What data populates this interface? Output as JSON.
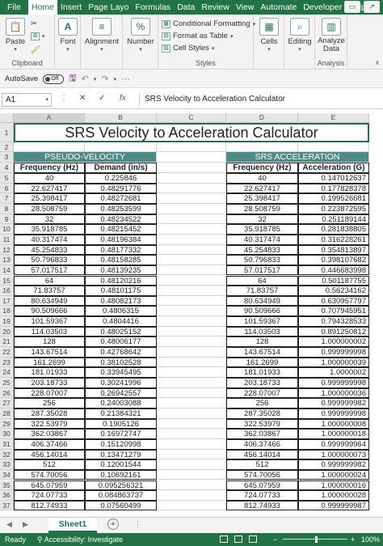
{
  "ribbon": {
    "tabs": [
      "File",
      "Home",
      "Insert",
      "Page Layout",
      "Formulas",
      "Data",
      "Review",
      "View",
      "Automate",
      "Developer",
      "Help"
    ],
    "tabs_display": [
      "File",
      "Home",
      "Insert",
      "Page Layo",
      "Formulas",
      "Data",
      "Review",
      "View",
      "Automate",
      "Developer",
      "Help"
    ],
    "active_tab": "Home",
    "clipboard": {
      "paste_label": "Paste",
      "group_label": "Clipboard"
    },
    "font_label": "Font",
    "alignment_label": "Alignment",
    "number_label": "Number",
    "styles": {
      "conditional_formatting": "Conditional Formatting",
      "format_as_table": "Format as Table",
      "cell_styles": "Cell Styles",
      "group_label": "Styles"
    },
    "cells_label": "Cells",
    "editing_label": "Editing",
    "analysis": {
      "analyze_data": "Analyze Data",
      "analyze_line1": "Analyze",
      "analyze_line2": "Data",
      "group_label": "Analysis"
    }
  },
  "qat": {
    "autosave_label": "AutoSave",
    "autosave_state": "Off"
  },
  "formula_bar": {
    "name_box": "A1",
    "cancel": "✕",
    "enter": "✓",
    "fx": "fx",
    "content": "SRS Velocity to Acceleration Calculator"
  },
  "columns": [
    "A",
    "B",
    "C",
    "D",
    "E"
  ],
  "title": "SRS Velocity to Acceleration Calculator",
  "pseudo_velocity": {
    "header": "PSEUDO-VELOCITY",
    "col1": "Frequency (Hz)",
    "col2": "Demand (in/s)"
  },
  "srs_acceleration": {
    "header": "SRS ACCELERATION",
    "col1": "Frequency (Hz)",
    "col2": "Acceleration (G)"
  },
  "rows": [
    {
      "n": "5",
      "a": "40",
      "b": "0.225846",
      "d": "40",
      "e": "0.147012637"
    },
    {
      "n": "6",
      "a": "22.627417",
      "b": "0.48291776",
      "d": "22.627417",
      "e": "0.177828378"
    },
    {
      "n": "7",
      "a": "25.398417",
      "b": "0.48272681",
      "d": "25.398417",
      "e": "0.199526681"
    },
    {
      "n": "8",
      "a": "28.508759",
      "b": "0.48253599",
      "d": "28.508759",
      "e": "0.223872595"
    },
    {
      "n": "9",
      "a": "32",
      "b": "0.48234522",
      "d": "32",
      "e": "0.251189144"
    },
    {
      "n": "10",
      "a": "35.918785",
      "b": "0.48215452",
      "d": "35.918785",
      "e": "0.281838805"
    },
    {
      "n": "11",
      "a": "40.317474",
      "b": "0.48196384",
      "d": "40.317474",
      "e": "0.316228261"
    },
    {
      "n": "12",
      "a": "45.254833",
      "b": "0.48177332",
      "d": "45.254833",
      "e": "0.354813897"
    },
    {
      "n": "13",
      "a": "50.796833",
      "b": "0.48158285",
      "d": "50.796833",
      "e": "0.398107682"
    },
    {
      "n": "14",
      "a": "57.017517",
      "b": "0.48139235",
      "d": "57.017517",
      "e": "0.446683998"
    },
    {
      "n": "15",
      "a": "64",
      "b": "0.48120216",
      "d": "64",
      "e": "0.501187755"
    },
    {
      "n": "16",
      "a": "71.83757",
      "b": "0.48101175",
      "d": "71.83757",
      "e": "0.56234162"
    },
    {
      "n": "17",
      "a": "80.634949",
      "b": "0.48082173",
      "d": "80.634949",
      "e": "0.630957797"
    },
    {
      "n": "18",
      "a": "90.509666",
      "b": "0.4806315",
      "d": "90.509666",
      "e": "0.707945951"
    },
    {
      "n": "19",
      "a": "101.59367",
      "b": "0.4804416",
      "d": "101.59367",
      "e": "0.794328533"
    },
    {
      "n": "20",
      "a": "114.03503",
      "b": "0.48025152",
      "d": "114.03503",
      "e": "0.891250812"
    },
    {
      "n": "21",
      "a": "128",
      "b": "0.48006177",
      "d": "128",
      "e": "1.000000002"
    },
    {
      "n": "22",
      "a": "143.67514",
      "b": "0.42768642",
      "d": "143.67514",
      "e": "0.999999998"
    },
    {
      "n": "23",
      "a": "161.2699",
      "b": "0.38102528",
      "d": "161.2699",
      "e": "1.000000039"
    },
    {
      "n": "24",
      "a": "181.01933",
      "b": "0.33945495",
      "d": "181.01933",
      "e": "1.0000002"
    },
    {
      "n": "25",
      "a": "203.18733",
      "b": "0.30241996",
      "d": "203.18733",
      "e": "0.999999998"
    },
    {
      "n": "26",
      "a": "228.07007",
      "b": "0.26942557",
      "d": "228.07007",
      "e": "1.000000036"
    },
    {
      "n": "27",
      "a": "256",
      "b": "0.24003088",
      "d": "256",
      "e": "0.999999982"
    },
    {
      "n": "28",
      "a": "287.35028",
      "b": "0.21384321",
      "d": "287.35028",
      "e": "0.999999998"
    },
    {
      "n": "29",
      "a": "322.53979",
      "b": "0.1905126",
      "d": "322.53979",
      "e": "1.000000008"
    },
    {
      "n": "30",
      "a": "362.03867",
      "b": "0.16972747",
      "d": "362.03867",
      "e": "1.000000018"
    },
    {
      "n": "31",
      "a": "406.37466",
      "b": "0.15120998",
      "d": "406.37466",
      "e": "0.999999964"
    },
    {
      "n": "32",
      "a": "456.14014",
      "b": "0.13471279",
      "d": "456.14014",
      "e": "1.000000073"
    },
    {
      "n": "33",
      "a": "512",
      "b": "0.12001544",
      "d": "512",
      "e": "0.999999982"
    },
    {
      "n": "34",
      "a": "574.70056",
      "b": "0.10692161",
      "d": "574.70056",
      "e": "1.000000024"
    },
    {
      "n": "35",
      "a": "645.07959",
      "b": "0.095256321",
      "d": "645.07959",
      "e": "1.000000016"
    },
    {
      "n": "36",
      "a": "724.07733",
      "b": "0.084863737",
      "d": "724.07733",
      "e": "1.000000028"
    },
    {
      "n": "37",
      "a": "812.74933",
      "b": "0.07560499",
      "d": "812.74933",
      "e": "0.999999987"
    }
  ],
  "sheet_tabs": {
    "active": "Sheet1"
  },
  "status_bar": {
    "ready": "Ready",
    "accessibility": "Accessibility: Investigate",
    "zoom": "100%"
  }
}
